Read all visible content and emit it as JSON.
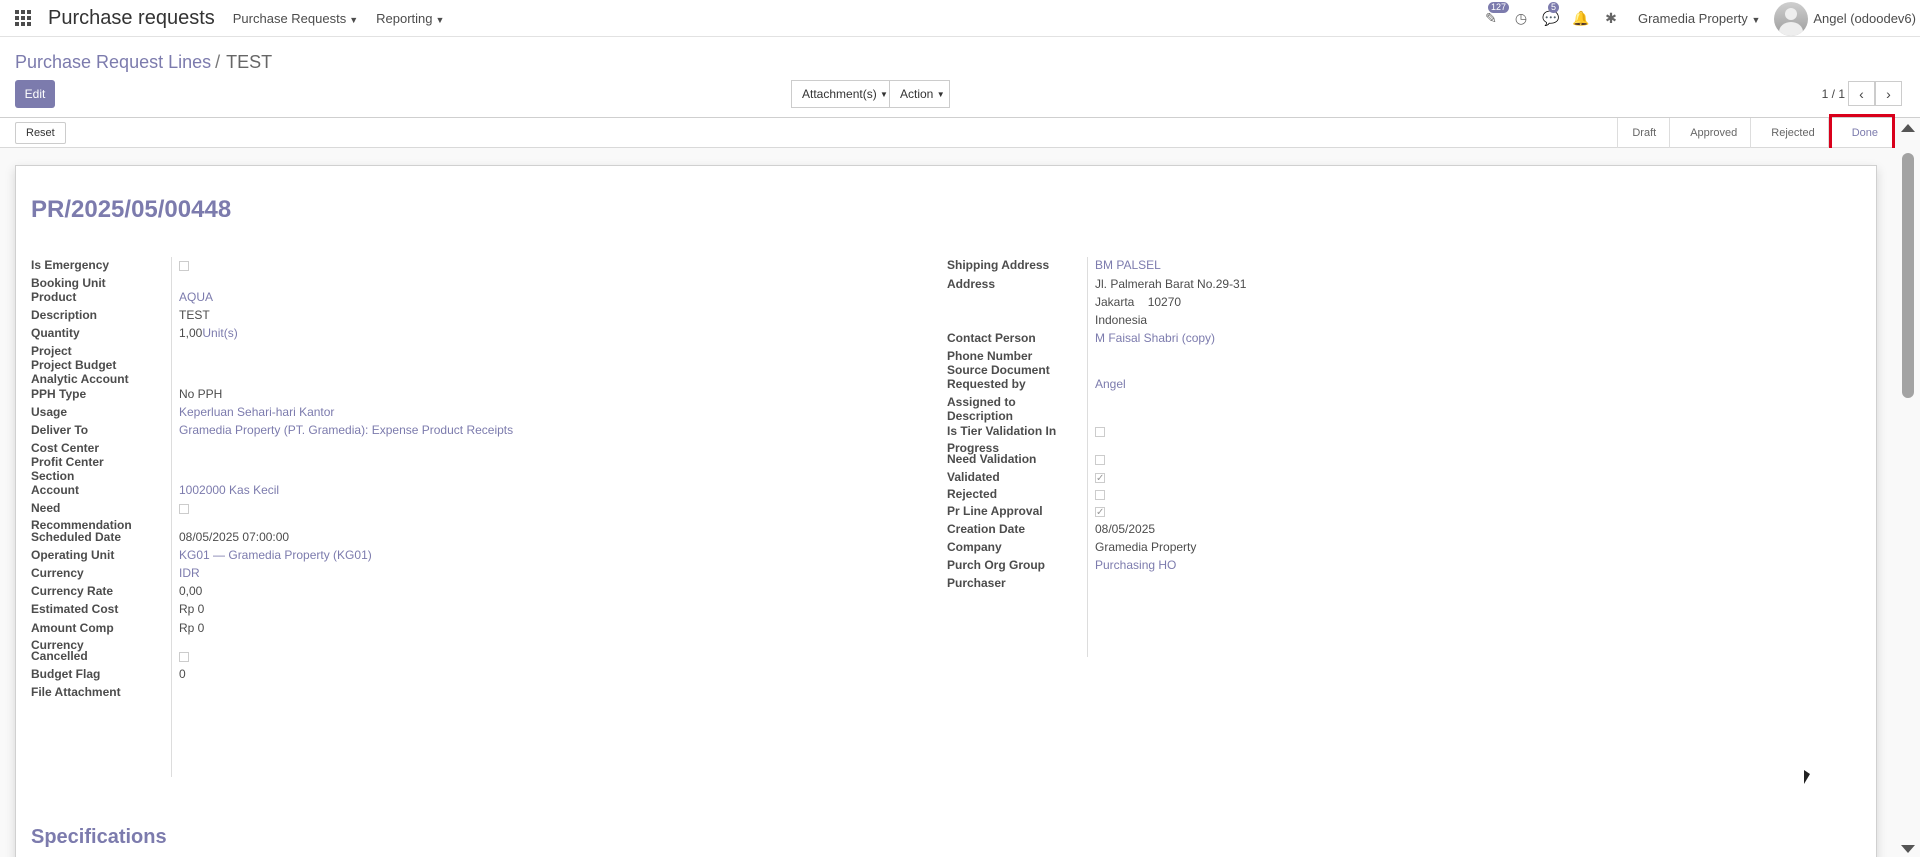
{
  "topbar": {
    "brand": "Purchase requests",
    "menus": [
      {
        "label": "Purchase Requests"
      },
      {
        "label": "Reporting"
      }
    ],
    "badges": {
      "activities": "127",
      "messages": "5"
    },
    "company": "Gramedia Property",
    "user": "Angel (odoodev6)"
  },
  "control": {
    "breadcrumb": {
      "parent": "Purchase Request Lines",
      "separator": "/",
      "current": "TEST"
    },
    "edit_label": "Edit",
    "attachments_label": "Attachment(s)",
    "action_label": "Action",
    "pager": "1 / 1"
  },
  "statusbar": {
    "reset_label": "Reset",
    "stages": [
      "Draft",
      "Approved",
      "Rejected",
      "Done"
    ],
    "active_stage": "Done"
  },
  "record": {
    "name": "PR/2025/05/00448",
    "left": {
      "is_emergency": {
        "label": "Is Emergency",
        "checked": false
      },
      "booking_unit": {
        "label": "Booking Unit",
        "value": ""
      },
      "product": {
        "label": "Product",
        "value": "AQUA"
      },
      "description": {
        "label": "Description",
        "value": "TEST"
      },
      "quantity": {
        "label": "Quantity",
        "value": "1,00",
        "uom": "Unit(s)"
      },
      "project": {
        "label": "Project",
        "value": ""
      },
      "project_budget": {
        "label": "Project Budget",
        "value": ""
      },
      "analytic_account": {
        "label": "Analytic Account",
        "value": ""
      },
      "pph_type": {
        "label": "PPH Type",
        "value": "No PPH"
      },
      "usage": {
        "label": "Usage",
        "value": "Keperluan Sehari-hari Kantor"
      },
      "deliver_to": {
        "label": "Deliver To",
        "value": "Gramedia Property (PT. Gramedia): Expense Product Receipts"
      },
      "cost_center": {
        "label": "Cost Center",
        "value": ""
      },
      "profit_center": {
        "label": "Profit Center",
        "value": ""
      },
      "section": {
        "label": "Section",
        "value": ""
      },
      "account": {
        "label": "Account",
        "value": "1002000 Kas Kecil"
      },
      "need_recommendation": {
        "label_1": "Need",
        "label_2": "Recommendation",
        "checked": false
      },
      "scheduled_date": {
        "label": "Scheduled Date",
        "value": "08/05/2025 07:00:00"
      },
      "operating_unit": {
        "label": "Operating Unit",
        "value": "KG01 — Gramedia Property (KG01)"
      },
      "currency": {
        "label": "Currency",
        "value": "IDR"
      },
      "currency_rate": {
        "label": "Currency Rate",
        "value": "0,00"
      },
      "estimated_cost": {
        "label": "Estimated Cost",
        "value": "Rp 0"
      },
      "amount_comp_currency": {
        "label_1": "Amount Comp",
        "label_2": "Currency",
        "value": "Rp 0"
      },
      "cancelled": {
        "label": "Cancelled",
        "checked": false
      },
      "budget_flag": {
        "label": "Budget Flag",
        "value": "0"
      },
      "file_attachment": {
        "label": "File Attachment",
        "value": ""
      }
    },
    "right": {
      "shipping_address": {
        "label": "Shipping Address",
        "value": "BM PALSEL"
      },
      "address": {
        "label": "Address",
        "line1": "Jl. Palmerah Barat No.29-31",
        "line2": "Jakarta    10270",
        "line3": "Indonesia"
      },
      "contact_person": {
        "label": "Contact Person",
        "value": "M Faisal Shabri (copy)"
      },
      "phone_number": {
        "label": "Phone Number",
        "value": ""
      },
      "source_document": {
        "label": "Source Document",
        "value": ""
      },
      "requested_by": {
        "label": "Requested by",
        "value": "Angel"
      },
      "assigned_to": {
        "label": "Assigned to",
        "value": ""
      },
      "description": {
        "label": "Description",
        "value": ""
      },
      "tier_validation": {
        "label_1": "Is Tier Validation In",
        "label_2": "Progress",
        "checked": false
      },
      "need_validation": {
        "label": "Need Validation",
        "checked": false
      },
      "validated": {
        "label": "Validated",
        "checked": true
      },
      "rejected": {
        "label": "Rejected",
        "checked": false
      },
      "pr_line_approval": {
        "label": "Pr Line Approval",
        "checked": true
      },
      "creation_date": {
        "label": "Creation Date",
        "value": "08/05/2025"
      },
      "company": {
        "label": "Company",
        "value": "Gramedia Property"
      },
      "purch_org_group": {
        "label": "Purch Org Group",
        "value": "Purchasing HO"
      },
      "purchaser": {
        "label": "Purchaser",
        "value": ""
      }
    },
    "specifications_title": "Specifications"
  },
  "colors": {
    "accent": "#7c7bad",
    "highlight": "#d9001b"
  }
}
